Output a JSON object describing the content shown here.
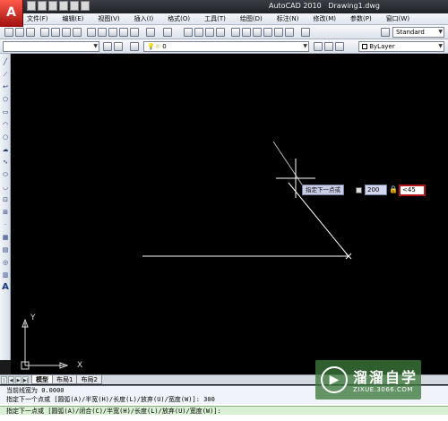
{
  "title_bar": {
    "app_name": "AutoCAD 2010",
    "document": "Drawing1.dwg"
  },
  "app_logo": "A",
  "menu": [
    "文件(F)",
    "编辑(E)",
    "视图(V)",
    "插入(I)",
    "格式(O)",
    "工具(T)",
    "绘图(D)",
    "标注(N)",
    "修改(M)",
    "参数(P)",
    "窗口(W)"
  ],
  "toolbar": {
    "text_style": "Standard",
    "layer_name": "0",
    "bylayer": "ByLayer"
  },
  "dynamic_input": {
    "prompt": "指定下一点或",
    "length": "200",
    "angle": "<45"
  },
  "ucs": {
    "y_label": "Y",
    "x_label": "X"
  },
  "tabs": [
    "模型",
    "布局1",
    "布局2"
  ],
  "command_line": {
    "history": [
      "当前线宽为 0.0000",
      "指定下一个点或 [圆弧(A)/半宽(H)/长度(L)/放弃(U)/宽度(W)]: 300"
    ],
    "current": "指定下一点或 [圆弧(A)/闭合(C)/半宽(H)/长度(L)/放弃(U)/宽度(W)]:"
  },
  "watermark": {
    "title": "溜溜自学",
    "subtitle": "ZIXUE.3066.COM"
  },
  "colors": {
    "canvas": "#000000",
    "line": "#ffffff",
    "angle_border": "#b01818",
    "watermark": "#3c783c"
  }
}
